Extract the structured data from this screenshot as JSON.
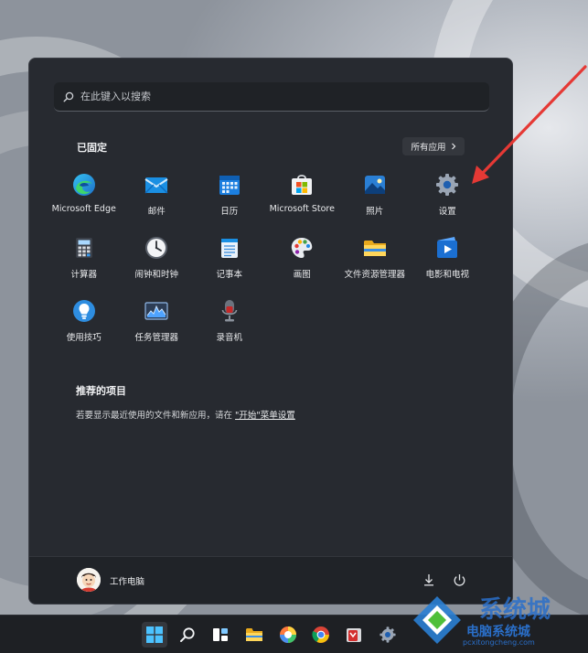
{
  "search": {
    "placeholder": "在此键入以搜索"
  },
  "pinned": {
    "title": "已固定",
    "all_apps_label": "所有应用"
  },
  "apps": [
    {
      "label": "Microsoft Edge",
      "icon": "edge-icon"
    },
    {
      "label": "邮件",
      "icon": "mail-icon"
    },
    {
      "label": "日历",
      "icon": "calendar-icon"
    },
    {
      "label": "Microsoft Store",
      "icon": "store-icon"
    },
    {
      "label": "照片",
      "icon": "photos-icon"
    },
    {
      "label": "设置",
      "icon": "settings-gear-icon"
    },
    {
      "label": "计算器",
      "icon": "calculator-icon"
    },
    {
      "label": "闹钟和时钟",
      "icon": "clock-icon"
    },
    {
      "label": "记事本",
      "icon": "notepad-icon"
    },
    {
      "label": "画图",
      "icon": "paint-palette-icon"
    },
    {
      "label": "文件资源管理器",
      "icon": "folder-icon"
    },
    {
      "label": "电影和电视",
      "icon": "movies-icon"
    },
    {
      "label": "使用技巧",
      "icon": "tips-lightbulb-icon"
    },
    {
      "label": "任务管理器",
      "icon": "task-manager-icon"
    },
    {
      "label": "录音机",
      "icon": "voice-recorder-icon"
    }
  ],
  "recommended": {
    "title": "推荐的项目",
    "text_prefix": "若要显示最近使用的文件和新应用，请在",
    "link": "\"开始\"菜单设置"
  },
  "user": {
    "name": "工作电脑"
  },
  "watermark": {
    "main": "系统城",
    "sub": "电脑系统城",
    "url": "pcxitongcheng.com"
  },
  "colors": {
    "menu_bg": "#272a30",
    "accent": "#0078d4",
    "arrow": "#e53935"
  }
}
